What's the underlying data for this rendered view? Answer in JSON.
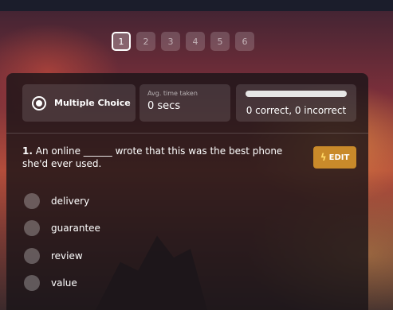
{
  "pager": {
    "pages": [
      "1",
      "2",
      "3",
      "4",
      "5",
      "6"
    ],
    "active": "1"
  },
  "stats": {
    "type_label": "Multiple Choice",
    "avg_label": "Avg. time taken",
    "avg_value": "0 secs",
    "accuracy_text": "0 correct, 0 incorrect",
    "correct_fraction": 0
  },
  "question": {
    "number": "1.",
    "text": "An online ______ wrote that this was the best phone she'd ever used.",
    "edit_label": "EDIT"
  },
  "options": [
    "delivery",
    "guarantee",
    "review",
    "value"
  ],
  "colors": {
    "edit_button": "#c98a2a",
    "bolt": "#ffd866"
  }
}
